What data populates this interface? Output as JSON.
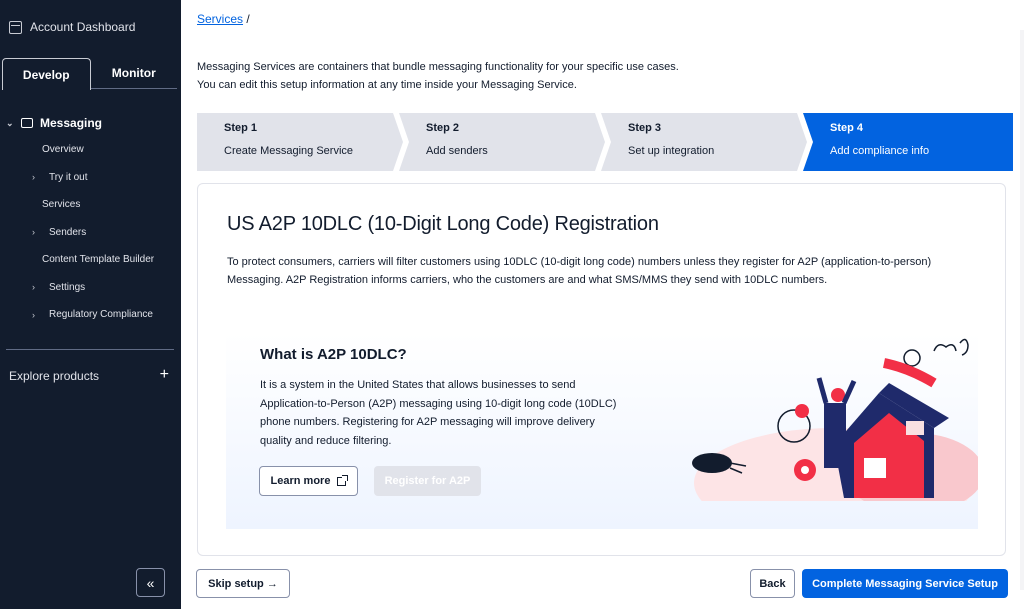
{
  "sidebar": {
    "account_label": "Account Dashboard",
    "tabs": [
      {
        "label": "Develop"
      },
      {
        "label": "Monitor"
      }
    ],
    "nav": {
      "heading": "Messaging",
      "items": [
        {
          "label": "Overview"
        },
        {
          "label": "Try it out"
        },
        {
          "label": "Services"
        },
        {
          "label": "Senders"
        },
        {
          "label": "Content Template Builder"
        },
        {
          "label": "Settings"
        },
        {
          "label": "Regulatory Compliance"
        }
      ]
    },
    "explore_label": "Explore products",
    "plus_glyph": "+",
    "collapse_glyph": "«"
  },
  "breadcrumb": {
    "link": "Services",
    "separator": "/"
  },
  "intro": {
    "line1": "Messaging Services are containers that bundle messaging functionality for your specific use cases.",
    "line2": "You can edit this setup information at any time inside your Messaging Service."
  },
  "steps": [
    {
      "num": "Step 1",
      "label": "Create Messaging Service"
    },
    {
      "num": "Step 2",
      "label": "Add senders"
    },
    {
      "num": "Step 3",
      "label": "Set up integration"
    },
    {
      "num": "Step 4",
      "label": "Add compliance info"
    }
  ],
  "card": {
    "title": "US A2P 10DLC (10-Digit Long Code) Registration",
    "description": "To protect consumers, carriers will filter customers using 10DLC (10-digit long code) numbers unless they register for A2P (application-to-person) Messaging. A2P Registration informs carriers, who the customers are and what SMS/MMS they send with 10DLC numbers."
  },
  "promo": {
    "heading": "What is A2P 10DLC?",
    "body": "It is a system in the United States that allows businesses to send Application-to-Person (A2P) messaging using 10-digit long code (10DLC) phone numbers. Registering for A2P messaging will improve delivery quality and reduce filtering.",
    "learn_more": "Learn more",
    "register": "Register for A2P"
  },
  "footer": {
    "skip": "Skip setup →",
    "back": "Back",
    "complete": "Complete Messaging Service Setup"
  },
  "colors": {
    "sidebar_bg": "#121c2d",
    "primary": "#0263e0",
    "step_inactive": "#e1e3ea",
    "accent_red": "#f22f46"
  }
}
